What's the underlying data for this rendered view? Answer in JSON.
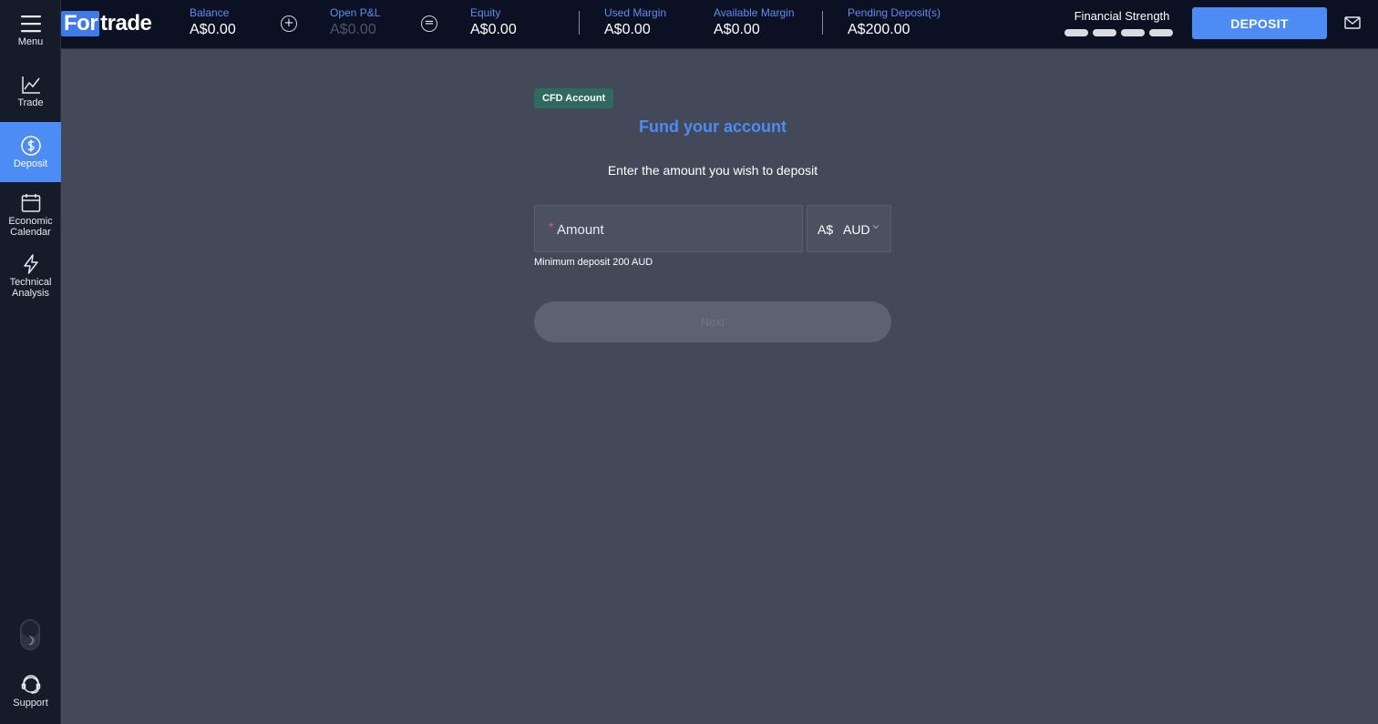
{
  "sidebar": {
    "items": [
      {
        "label": "Menu",
        "icon": "hamburger-icon"
      },
      {
        "label": "Trade",
        "icon": "chart-line-icon"
      },
      {
        "label": "Deposit",
        "icon": "dollar-circle-icon",
        "active": true
      },
      {
        "label": "Economic Calendar",
        "icon": "calendar-icon"
      },
      {
        "label": "Technical Analysis",
        "icon": "lightning-icon"
      }
    ],
    "theme_toggle_icon": "moon-icon",
    "support": {
      "label": "Support",
      "icon": "headset-icon"
    }
  },
  "header": {
    "logo": {
      "part1": "For",
      "part2": "trade"
    },
    "stats": {
      "balance": {
        "label": "Balance",
        "value": "A$0.00"
      },
      "open_pnl": {
        "label": "Open P&L",
        "value": "A$0.00"
      },
      "equity": {
        "label": "Equity",
        "value": "A$0.00"
      },
      "used_margin": {
        "label": "Used Margin",
        "value": "A$0.00"
      },
      "available_margin": {
        "label": "Available Margin",
        "value": "A$0.00"
      },
      "pending_deposits": {
        "label": "Pending Deposit(s)",
        "value": "A$200.00"
      }
    },
    "operators": {
      "plus": "+",
      "equals": "="
    },
    "financial_strength": {
      "label": "Financial Strength",
      "bars": 4
    },
    "deposit_button": "DEPOSIT",
    "mail_icon": "mail-icon"
  },
  "form": {
    "badge": "CFD Account",
    "title": "Fund your account",
    "subtitle": "Enter the amount you wish to deposit",
    "amount": {
      "required_mark": "*",
      "placeholder": "Amount",
      "value": ""
    },
    "currency": {
      "symbol": "A$",
      "code": "AUD",
      "icon": "chevron-down-icon"
    },
    "hint": "Minimum deposit 200 AUD",
    "next_button": "Next"
  },
  "colors": {
    "accent": "#4d8bf5",
    "background": "#434958",
    "sidebar": "#161b2a",
    "header": "#0b1022",
    "badge": "#2e6a5e"
  }
}
